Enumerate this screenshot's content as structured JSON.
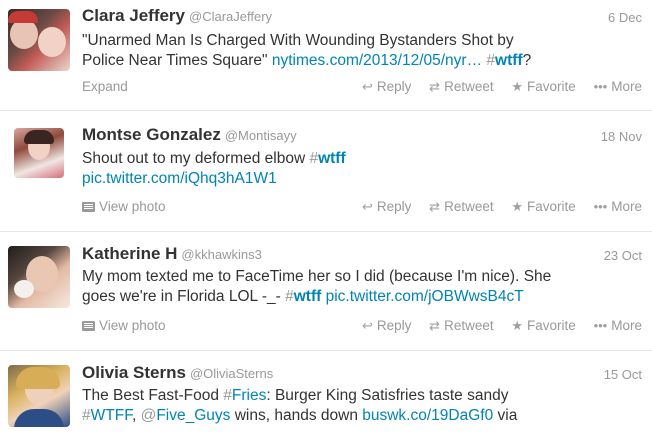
{
  "tweets": [
    {
      "name": "Clara Jeffery",
      "handle": "@ClaraJeffery",
      "date": "6 Dec",
      "line1": "\"Unarmed Man Is Charged With Wounding Bystanders Shot by",
      "line2_text": "Police Near Times Square\" ",
      "line2_link": "nytimes.com/2013/12/05/nyr…",
      "line2_hash_mark": "#",
      "line2_hash": "wtff",
      "line2_tail": "?",
      "left_action": "Expand",
      "actions": {
        "reply": "Reply",
        "retweet": "Retweet",
        "favorite": "Favorite",
        "more": "More"
      }
    },
    {
      "name": "Montse Gonzalez",
      "handle": "@Montisayy",
      "date": "18 Nov",
      "line1_text": "Shout out to my deformed elbow ",
      "line1_hash_mark": "#",
      "line1_hash": "wtff",
      "line2_link": "pic.twitter.com/iQhq3hA1W1",
      "left_action": "View photo",
      "actions": {
        "reply": "Reply",
        "retweet": "Retweet",
        "favorite": "Favorite",
        "more": "More"
      }
    },
    {
      "name": "Katherine H",
      "handle": "@kkhawkins3",
      "date": "23 Oct",
      "line1": "My mom texted me to FaceTime her so I did (because I'm nice). She",
      "line2_text": "goes we're in Florida LOL -_- ",
      "line2_hash_mark": "#",
      "line2_hash": "wtff",
      "line2_link": "pic.twitter.com/jOBWwsB4cT",
      "left_action": "View photo",
      "actions": {
        "reply": "Reply",
        "retweet": "Retweet",
        "favorite": "Favorite",
        "more": "More"
      }
    },
    {
      "name": "Olivia Sterns",
      "handle": "@OliviaSterns",
      "date": "15 Oct",
      "line1_text": "The Best Fast-Food ",
      "line1_hash_mark": "#",
      "line1_hash": "Fries",
      "line1_tail": ": Burger King Satisfries taste sandy",
      "line2_hash_mark": "#",
      "line2_hash": "WTFF",
      "line2_sep": ", ",
      "line2_mention_mark": "@",
      "line2_mention": "Five_Guys",
      "line2_mid": " wins, hands down ",
      "line2_link": "buswk.co/19DaGf0",
      "line2_tail": " via"
    }
  ]
}
